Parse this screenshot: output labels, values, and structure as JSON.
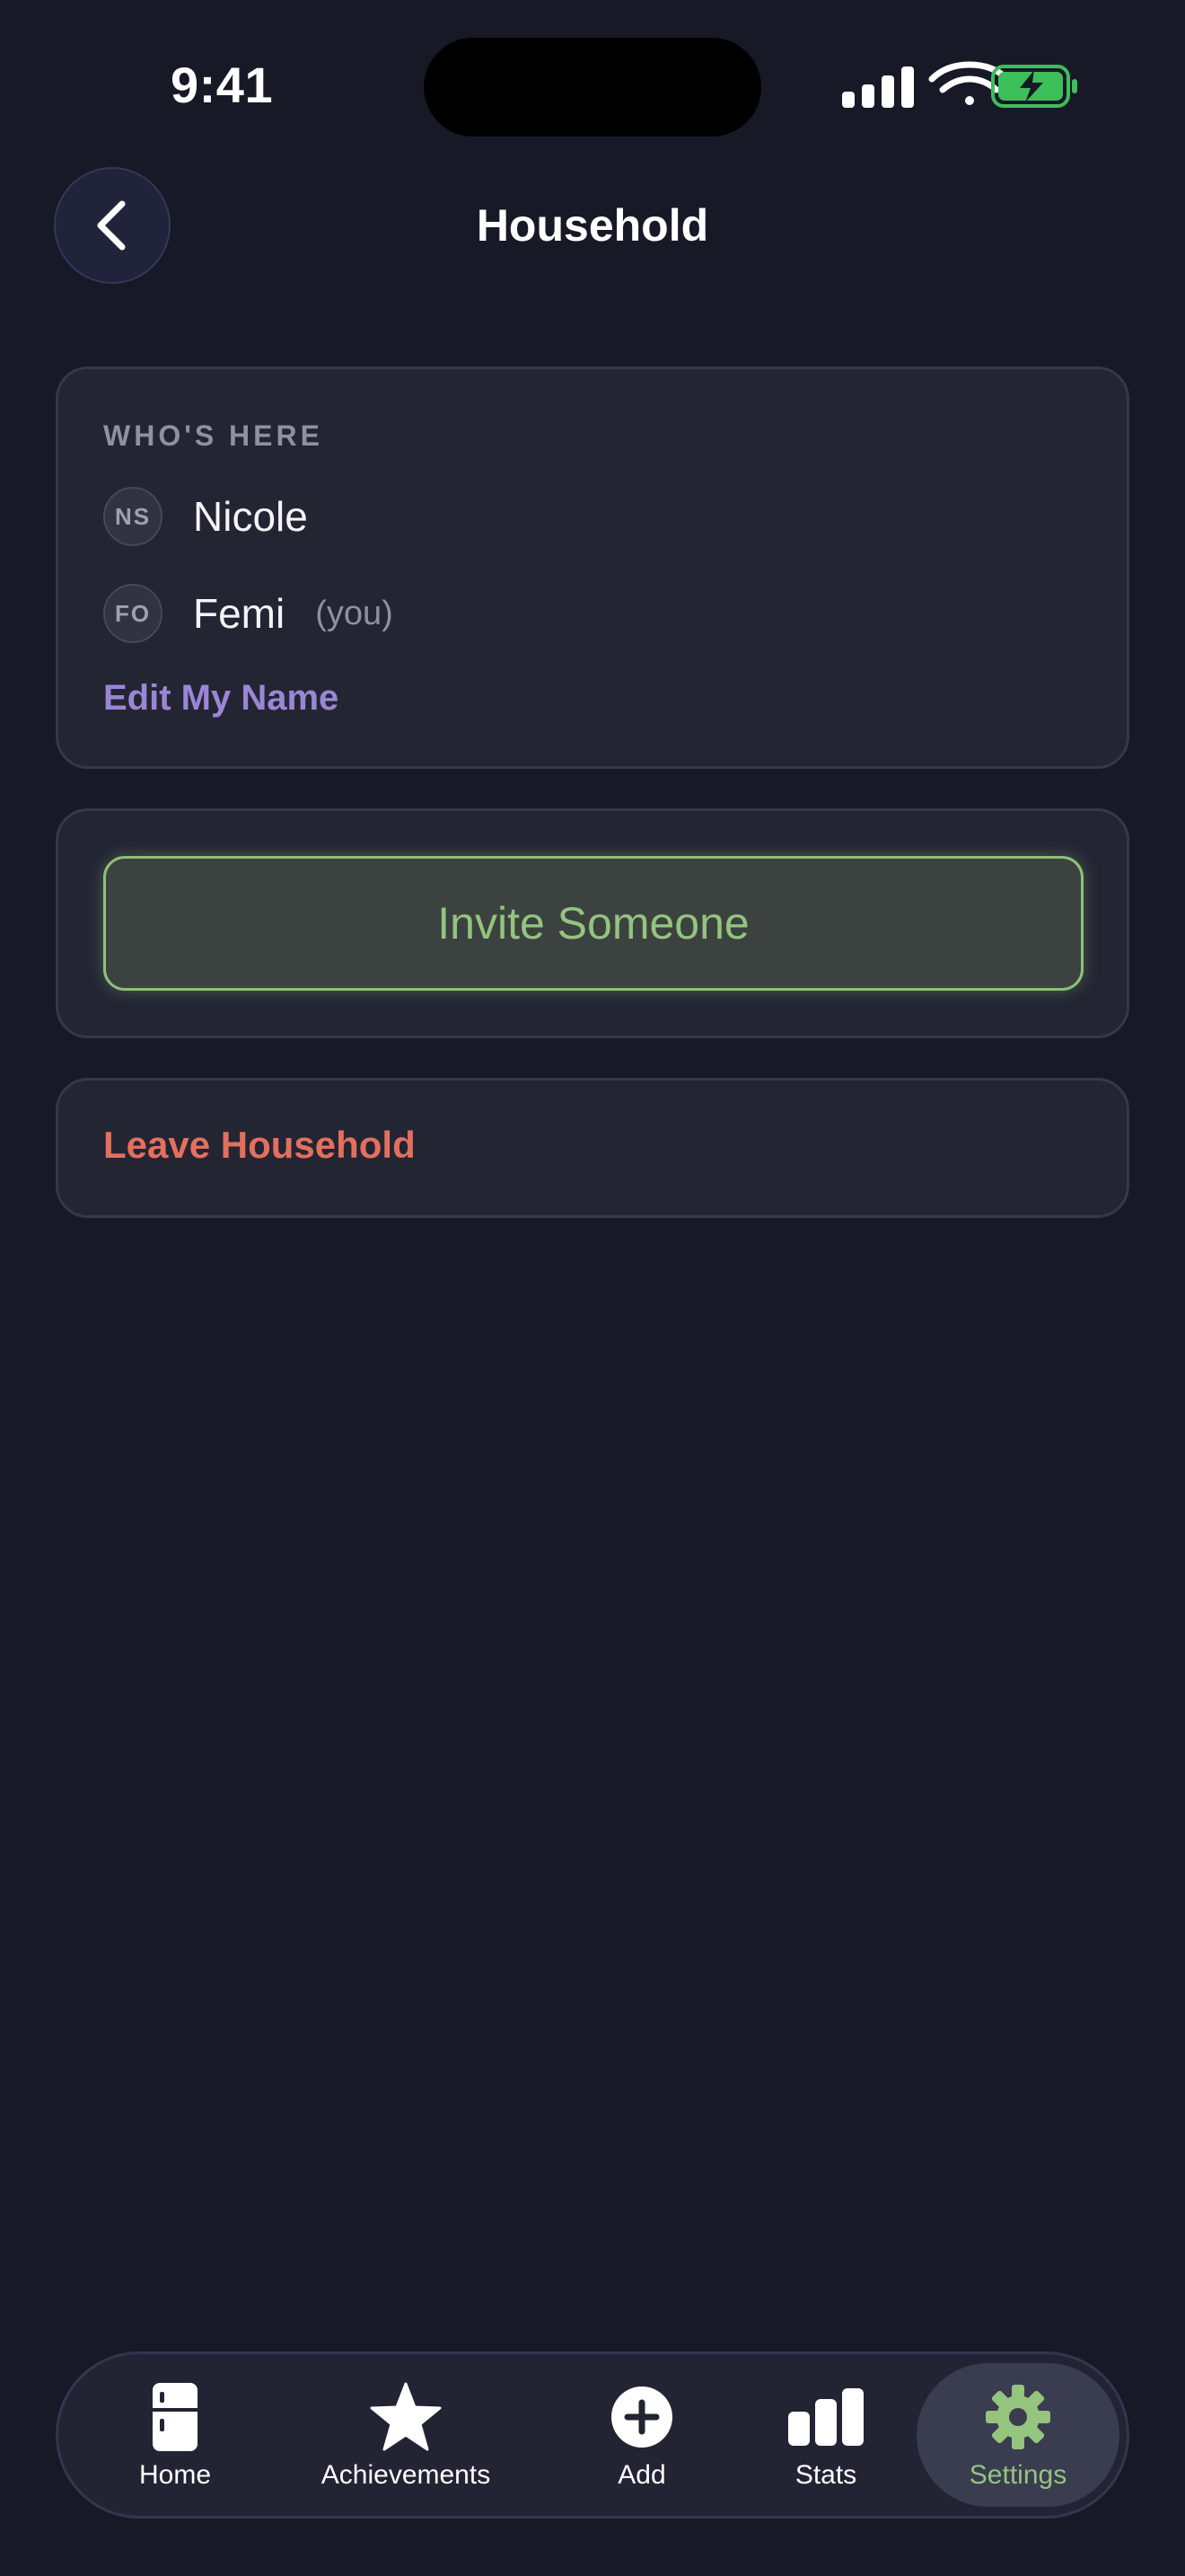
{
  "status_bar": {
    "time": "9:41",
    "icons": [
      "signal-icon",
      "wifi-icon",
      "battery-charging-icon"
    ]
  },
  "header": {
    "title": "Household",
    "back_icon": "chevron-left-icon"
  },
  "members_card": {
    "section_label": "WHO'S HERE",
    "members": [
      {
        "initials": "NS",
        "name": "Nicole",
        "tag": ""
      },
      {
        "initials": "FO",
        "name": "Femi",
        "tag": "(you)"
      }
    ],
    "edit_link": "Edit My Name"
  },
  "invite_card": {
    "button_label": "Invite Someone"
  },
  "leave_card": {
    "link_label": "Leave Household"
  },
  "tab_bar": {
    "items": [
      {
        "label": "Home",
        "icon": "fridge-icon",
        "active": false
      },
      {
        "label": "Achievements",
        "icon": "star-icon",
        "active": false
      },
      {
        "label": "Add",
        "icon": "plus-circle-icon",
        "active": false
      },
      {
        "label": "Stats",
        "icon": "bar-chart-icon",
        "active": false
      },
      {
        "label": "Settings",
        "icon": "gear-icon",
        "active": true
      }
    ]
  },
  "colors": {
    "background": "#181926",
    "card": "#232533",
    "accent_green": "#94c47e",
    "accent_purple": "#9b86d6",
    "danger": "#e3705e",
    "muted_text": "#8e90a3"
  }
}
